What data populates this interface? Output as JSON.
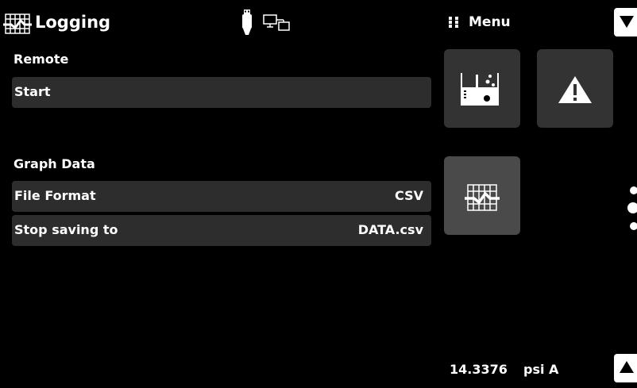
{
  "header": {
    "title": "Logging",
    "title_icon": "chart-grid-icon",
    "usb_icon": "usb-icon",
    "network_icon": "remote-computer-icon",
    "menu_icon": "menu-dots-icon",
    "menu_label": "Menu"
  },
  "logging": {
    "remote_section": "Remote",
    "start_label": "Start",
    "graph_section": "Graph Data",
    "file_format_label": "File Format",
    "file_format_value": "CSV",
    "stop_saving_label": "Stop saving to",
    "stop_saving_value": "DATA.csv"
  },
  "tiles": [
    {
      "icon": "measure-beaker-icon"
    },
    {
      "icon": "warning-icon"
    },
    {
      "icon": "logging-chart-icon",
      "active": true
    }
  ],
  "pager": {
    "pages": 3,
    "active_page": 2
  },
  "reading": {
    "value": "14.3376",
    "unit": "psi A"
  },
  "colors": {
    "background": "#000000",
    "row": "#2d2d2d",
    "tile": "#333333",
    "tile_active": "#4a4a4a",
    "text": "#ffffff"
  }
}
